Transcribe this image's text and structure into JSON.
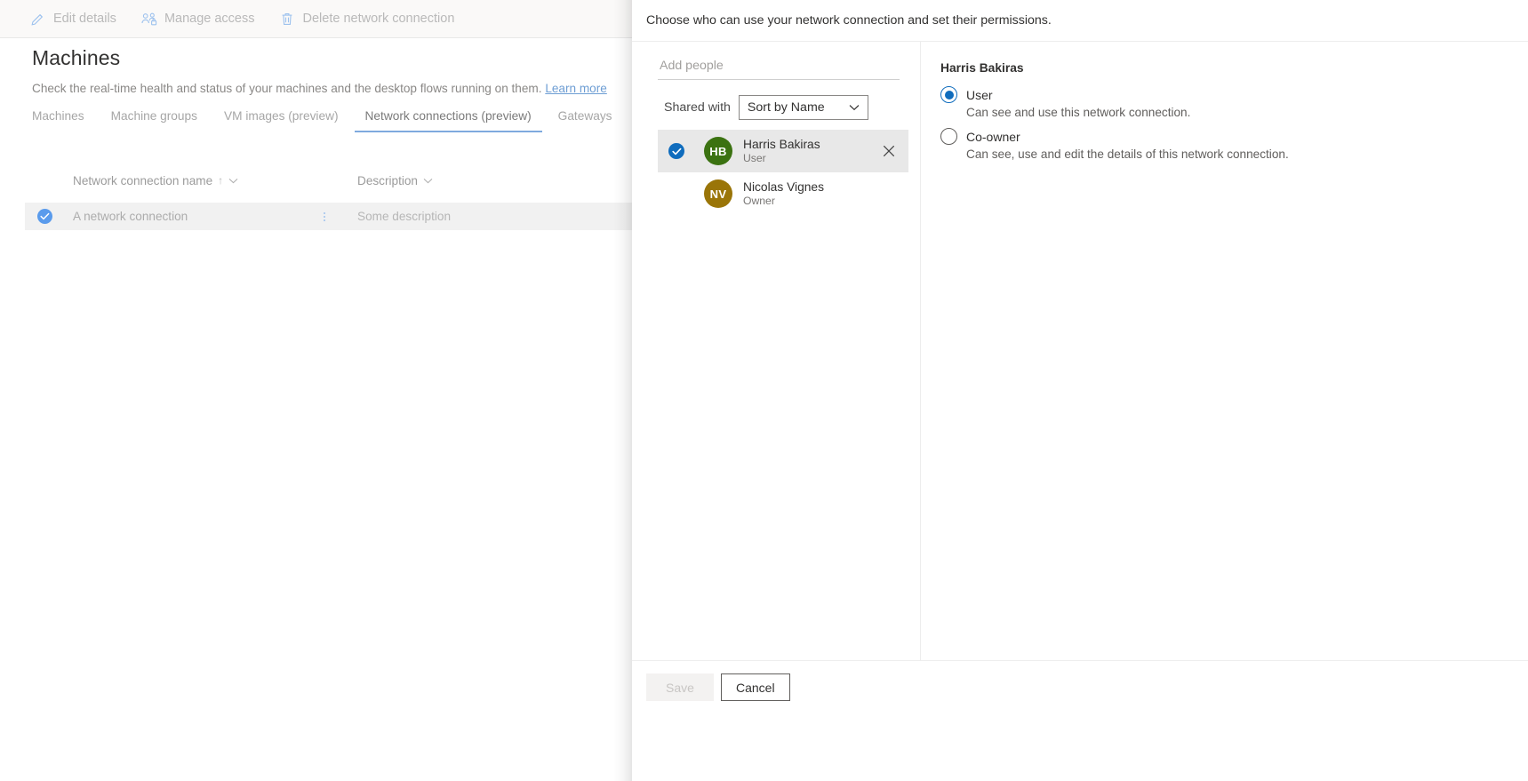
{
  "command_bar": {
    "buttons": [
      {
        "label": "Edit details",
        "icon": "pencil-icon"
      },
      {
        "label": "Manage access",
        "icon": "manage-access-icon"
      },
      {
        "label": "Delete network connection",
        "icon": "trash-icon"
      }
    ]
  },
  "page": {
    "title": "Machines",
    "subtitle": "Check the real-time health and status of your machines and the desktop flows running on them.",
    "learn_more": "Learn more"
  },
  "tabs": [
    {
      "label": "Machines",
      "active": false
    },
    {
      "label": "Machine groups",
      "active": false
    },
    {
      "label": "VM images (preview)",
      "active": false
    },
    {
      "label": "Network connections (preview)",
      "active": true
    },
    {
      "label": "Gateways",
      "active": false
    }
  ],
  "table": {
    "columns": [
      {
        "label": "Network connection name",
        "sort": "↑"
      },
      {
        "label": "Description",
        "sort": ""
      }
    ],
    "rows": [
      {
        "name": "A network connection",
        "description": "Some description",
        "selected": true
      }
    ]
  },
  "panel": {
    "header": "Choose who can use your network connection and set their permissions.",
    "add_people": {
      "placeholder": "Add people",
      "value": ""
    },
    "shared_with_label": "Shared with",
    "sort": {
      "selected": "Sort by Name",
      "options": [
        "Sort by Name"
      ]
    },
    "people": [
      {
        "name": "Harris Bakiras",
        "role": "User",
        "initials": "HB",
        "avatar_color": "#3b7211",
        "selected": true,
        "removable": true
      },
      {
        "name": "Nicolas Vignes",
        "role": "Owner",
        "initials": "NV",
        "avatar_color": "#9a7508",
        "selected": false,
        "removable": false
      }
    ],
    "permissions": {
      "title": "Harris Bakiras",
      "options": [
        {
          "label": "User",
          "description": "Can see and use this network connection.",
          "checked": true
        },
        {
          "label": "Co-owner",
          "description": "Can see, use and edit the details of this network connection.",
          "checked": false
        }
      ]
    },
    "footer": {
      "save_label": "Save",
      "save_disabled": true,
      "cancel_label": "Cancel"
    }
  },
  "colors": {
    "accent_blue": "#0f6cbd",
    "tab_underline": "#7faade",
    "row_selected_bg": "#f1f1f1",
    "person_selected_bg": "#e8e8e8"
  }
}
